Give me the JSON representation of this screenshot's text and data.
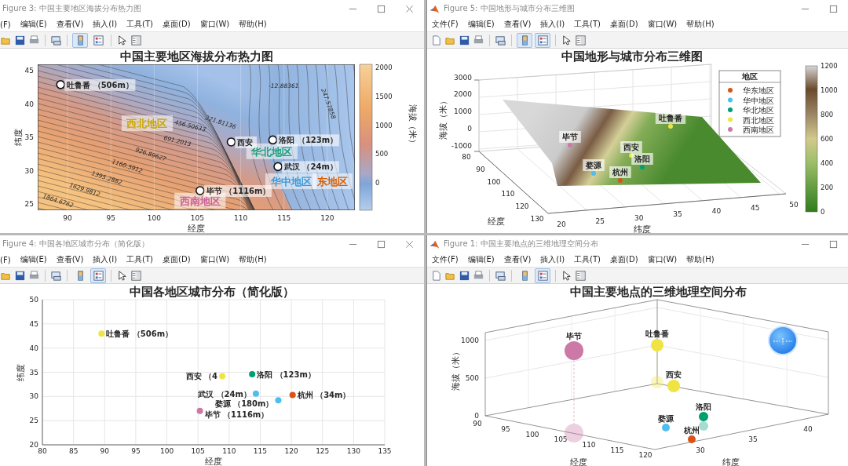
{
  "windows": [
    {
      "title": "Figure 3: 中国主要地区海拔分布热力图",
      "cut_left": true,
      "cut_right": false,
      "menu": [
        "(F)",
        "编辑(E)",
        "查看(V)",
        "插入(I)",
        "工具(T)",
        "桌面(D)",
        "窗口(W)",
        "帮助(H)"
      ],
      "toolbar": {
        "colorbar": true,
        "legend": false
      },
      "figure": {
        "kind": "contour",
        "title": "中国主要地区海拔分布热力图",
        "xlabel": "经度",
        "ylabel": "纬度",
        "xticks": [
          "90",
          "95",
          "100",
          "105",
          "110",
          "115",
          "120"
        ],
        "yticks": [
          "45",
          "40",
          "35",
          "30",
          "25"
        ],
        "colorbar": {
          "label": "海拔（米）",
          "ticks": [
            "2000",
            "1500",
            "1000",
            "500",
            "0"
          ]
        },
        "contour_labels": [
          "-12.88361",
          "247.57858",
          "221.81136",
          "456.50633",
          "691.2013",
          "926.89627",
          "1160.5912",
          "1395.2882",
          "1629.9812",
          "1864.6762"
        ],
        "cities": [
          {
            "label": "吐鲁番 （506m）"
          },
          {
            "label": "西安"
          },
          {
            "label": "洛阳 （123m）"
          },
          {
            "label": "武汉 （24m）"
          },
          {
            "label": "毕节 （1116m）"
          }
        ],
        "regions": [
          {
            "label": "西北地区",
            "color": "#c9a800"
          },
          {
            "label": "华北地区",
            "color": "#1b9e77"
          },
          {
            "label": "华中地区",
            "color": "#3a9ad9"
          },
          {
            "label": "东地区",
            "color": "#d95f02"
          },
          {
            "label": "西南地区",
            "color": "#cc5f9a"
          }
        ]
      }
    },
    {
      "title": "Figure 5: 中国地形与城市分布三维图",
      "cut_left": false,
      "cut_right": true,
      "menu": [
        "文件(F)",
        "编辑(E)",
        "查看(V)",
        "插入(I)",
        "工具(T)",
        "桌面(D)",
        "窗口(W)",
        "帮助(H)"
      ],
      "toolbar": {
        "colorbar": true,
        "legend": true
      },
      "figure": {
        "kind": "surface3d",
        "title": "中国地形与城市分布三维图",
        "zlabel": "海拔（米）",
        "zticks": [
          "3000",
          "2000",
          "1000",
          "0",
          "-1000"
        ],
        "xlabel": "经度",
        "xticks": [
          "80",
          "90",
          "100",
          "110",
          "120",
          "130"
        ],
        "ylabel": "纬度",
        "yticks": [
          "20",
          "25",
          "30",
          "35",
          "40",
          "45",
          "50"
        ],
        "legend": {
          "title": "地区",
          "items": [
            {
              "label": "华东地区",
              "color": "#d95319"
            },
            {
              "label": "华中地区",
              "color": "#4dbeee"
            },
            {
              "label": "华北地区",
              "color": "#009e73"
            },
            {
              "label": "西北地区",
              "color": "#f0e442"
            },
            {
              "label": "西南地区",
              "color": "#cc79a7"
            }
          ]
        },
        "colorbar": {
          "ticks": [
            "1200",
            "1000",
            "800",
            "600",
            "400",
            "200",
            "0"
          ]
        },
        "cities": [
          {
            "label": "吐鲁番",
            "color": "#f0e442"
          },
          {
            "label": "毕节",
            "color": "#cc79a7"
          },
          {
            "label": "西安",
            "color": "#f0e442"
          },
          {
            "label": "洛阳",
            "color": "#009e73"
          },
          {
            "label": "婺源",
            "color": "#4dbeee"
          },
          {
            "label": "杭州",
            "color": "#d95319"
          }
        ]
      }
    },
    {
      "title": "Figure 4: 中国各地区城市分布（简化版）",
      "cut_left": true,
      "cut_right": false,
      "menu": [
        "(F)",
        "编辑(E)",
        "查看(V)",
        "插入(I)",
        "工具(T)",
        "桌面(D)",
        "窗口(W)",
        "帮助(H)"
      ],
      "toolbar": {
        "colorbar": false,
        "legend": true
      },
      "figure": {
        "kind": "scatter",
        "chart_data": {
          "type": "scatter",
          "title": "中国各地区城市分布（简化版）",
          "xlabel": "经度",
          "ylabel": "纬度",
          "xlim": [
            80,
            135
          ],
          "ylim": [
            20,
            50
          ],
          "grid": true,
          "xticks": [
            80,
            85,
            90,
            95,
            100,
            105,
            110,
            115,
            120,
            125,
            130,
            135
          ],
          "yticks": [
            20,
            25,
            30,
            35,
            40,
            45,
            50
          ],
          "series": [
            {
              "color": "#f0e442",
              "x": [
                89.5,
                108.9
              ],
              "values": [
                43.0,
                34.2
              ]
            },
            {
              "color": "#009e73",
              "x": [
                113.7
              ],
              "values": [
                34.6
              ]
            },
            {
              "color": "#4dbeee",
              "x": [
                114.3,
                117.9
              ],
              "values": [
                30.6,
                29.2
              ]
            },
            {
              "color": "#d95319",
              "x": [
                120.2
              ],
              "values": [
                30.3
              ]
            },
            {
              "color": "#cc79a7",
              "x": [
                105.3
              ],
              "values": [
                27.0
              ]
            }
          ],
          "annotations": [
            {
              "x": 89.5,
              "y": 43.0,
              "text": "吐鲁番 （506m）"
            },
            {
              "x": 108.9,
              "y": 34.2,
              "text": "西安 （4"
            },
            {
              "x": 113.7,
              "y": 34.6,
              "text": "洛阳 （123m）"
            },
            {
              "x": 114.3,
              "y": 30.6,
              "text": "武汉 （24m）"
            },
            {
              "x": 120.2,
              "y": 30.3,
              "text": "杭州 （34m）"
            },
            {
              "x": 117.9,
              "y": 29.2,
              "text": "婺源 （180m）"
            },
            {
              "x": 105.3,
              "y": 27.0,
              "text": "毕节 （1116m）"
            }
          ]
        }
      }
    },
    {
      "title": "Figure 1: 中国主要地点的三维地理空间分布",
      "cut_left": false,
      "cut_right": true,
      "menu": [
        "文件(F)",
        "编辑(E)",
        "查看(V)",
        "插入(I)",
        "工具(T)",
        "桌面(D)",
        "窗口(W)",
        "帮助(H)"
      ],
      "toolbar": {
        "colorbar": false,
        "legend": true
      },
      "figure": {
        "kind": "bubble3d",
        "title": "中国主要地点的三维地理空间分布",
        "zlabel": "海拔（米）",
        "zticks": [
          "1000",
          "500",
          "0"
        ],
        "xlabel": "经度",
        "xticks": [
          "90",
          "95",
          "100",
          "105",
          "110",
          "115",
          "120"
        ],
        "ylabel": "纬度",
        "yticks": [
          "30",
          "35",
          "40"
        ],
        "cities": [
          {
            "label": "毕节",
            "color": "#cc79a7"
          },
          {
            "label": "吐鲁番",
            "color": "#f0e442"
          },
          {
            "label": "西安",
            "color": "#f0e442"
          },
          {
            "label": "洛阳",
            "color": "#009e73"
          },
          {
            "label": "婺源",
            "color": "#4dbeee"
          },
          {
            "label": "杭州",
            "color": "#d95319"
          }
        ]
      }
    }
  ]
}
